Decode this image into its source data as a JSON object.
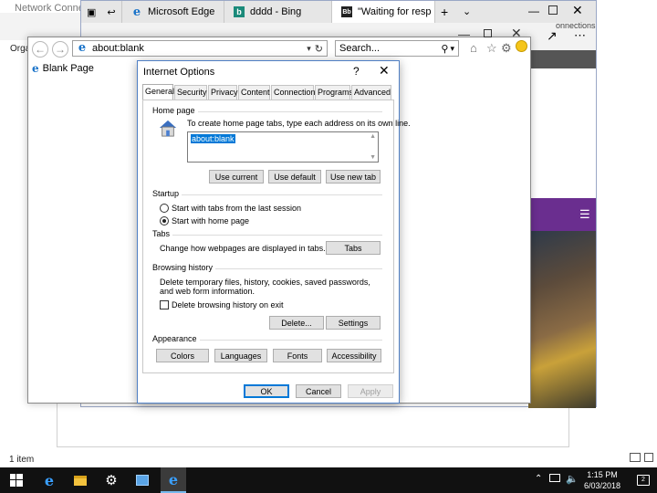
{
  "explorer": {
    "title": "Network Connectio",
    "toolbar_label": "Orga",
    "status": "1 item"
  },
  "edge": {
    "tabs": [
      {
        "label": "Microsoft Edge",
        "icon": "edge-logo-icon"
      },
      {
        "label": "dddd - Bing",
        "icon": "bing-logo-icon"
      },
      {
        "label": "\"Waiting for resp",
        "icon": "page-icon"
      }
    ],
    "side_label": "onnections"
  },
  "ie": {
    "address": "about:blank",
    "search_placeholder": "Search...",
    "tab_label": "Blank Page"
  },
  "dialog": {
    "title": "Internet Options",
    "help": "?",
    "tabs": [
      "General",
      "Security",
      "Privacy",
      "Content",
      "Connections",
      "Programs",
      "Advanced"
    ],
    "home_page": {
      "heading": "Home page",
      "description": "To create home page tabs, type each address on its own line.",
      "urls": "about:blank",
      "use_current": "Use current",
      "use_default": "Use default",
      "use_new_tab": "Use new tab"
    },
    "startup": {
      "heading": "Startup",
      "option_last_session": "Start with tabs from the last session",
      "option_home_page": "Start with home page",
      "selected": "home_page"
    },
    "tabs_group": {
      "heading": "Tabs",
      "description": "Change how webpages are displayed in tabs.",
      "button": "Tabs"
    },
    "browsing_history": {
      "heading": "Browsing history",
      "description": "Delete temporary files, history, cookies, saved passwords, and web form information.",
      "delete_on_exit": "Delete browsing history on exit",
      "delete_on_exit_checked": false,
      "delete_button": "Delete...",
      "settings_button": "Settings"
    },
    "appearance": {
      "heading": "Appearance",
      "colors": "Colors",
      "languages": "Languages",
      "fonts": "Fonts",
      "accessibility": "Accessibility"
    },
    "footer": {
      "ok": "OK",
      "cancel": "Cancel",
      "apply": "Apply"
    }
  },
  "taskbar": {
    "time": "1:15 PM",
    "date": "6/03/2018",
    "notifications": "2"
  },
  "colors": {
    "taskbar": "#111111",
    "accent": "#0078d7",
    "edge_purple": "#6a2e8f"
  }
}
